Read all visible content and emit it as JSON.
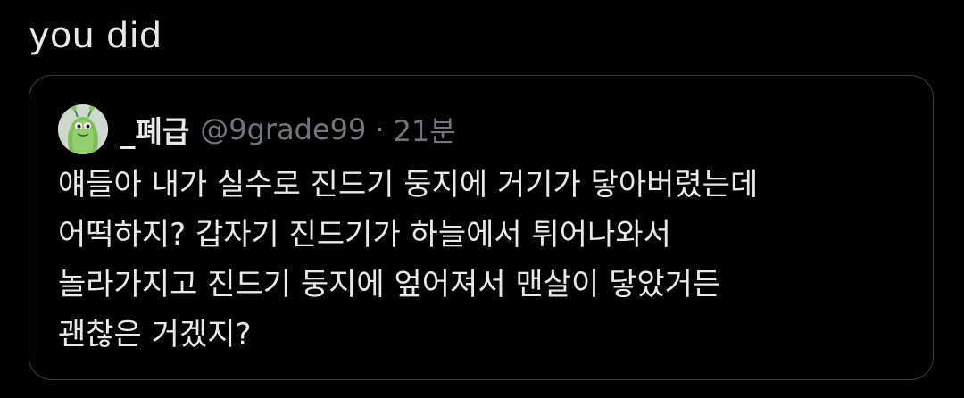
{
  "tweet": {
    "text": "you did"
  },
  "quoted_tweet": {
    "display_name": "_폐급",
    "handle": "@9grade99",
    "separator": "·",
    "timestamp": "21분",
    "avatar_icon": "green-character-avatar",
    "lines": [
      "얘들아 내가 실수로 진드기 둥지에 거기가 닿아버렸는데",
      "어떡하지? 갑자기 진드기가 하늘에서 튀어나와서",
      "놀라가지고 진드기 둥지에 엎어져서 맨살이 닿았거든",
      "괜찮은 거겠지?"
    ]
  },
  "colors": {
    "background": "#000000",
    "primary_text": "#e7e9ea",
    "secondary_text": "#71767b",
    "border": "#3a3d41"
  }
}
